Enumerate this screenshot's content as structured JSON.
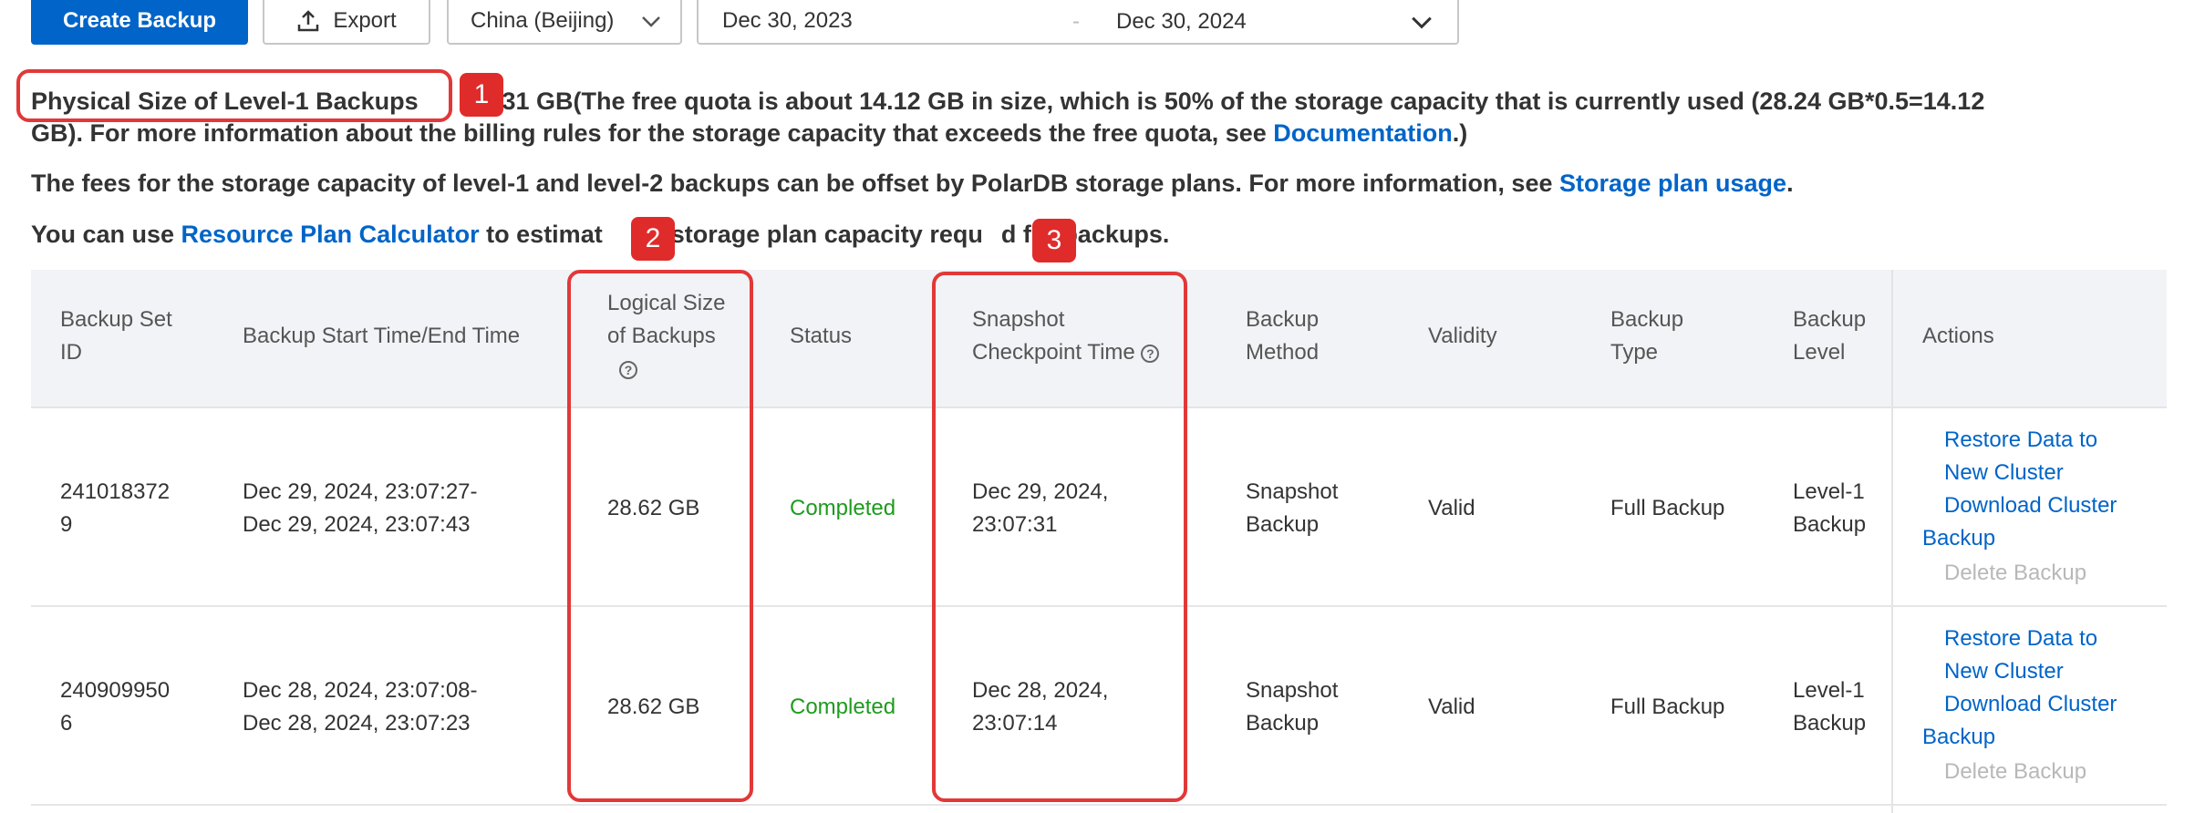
{
  "toolbar": {
    "create_label": "Create Backup",
    "export_label": "Export",
    "region": "China (Beijing)",
    "date_start": "Dec 30, 2023",
    "date_sep": "-",
    "date_end": "Dec 30, 2024"
  },
  "info": {
    "physical_label": "Physical Size of Level-1 Backups",
    "physical_rest": "2.31 GB(The free quota is about 14.12 GB in size, which is 50% of the storage capacity that is currently used (28.24 GB*0.5=14.12",
    "line1b_text": "GB). For more information about the billing rules for the storage capacity that exceeds the free quota, see ",
    "doc_link": "Documentation",
    "line1b_end": ".)",
    "line2_text": "The fees for the storage capacity of level-1 and level-2 backups can be offset by PolarDB storage plans. For more information, see ",
    "plan_link": "Storage plan usage",
    "line2_end": ".",
    "line3_a": "You can use ",
    "calc_link": "Resource Plan Calculator",
    "line3_b": " to estimat",
    "line3_c": "he storage plan capacity requ",
    "line3_d": "d for backups."
  },
  "table": {
    "headers": {
      "id_1": "Backup Set",
      "id_2": "ID",
      "time": "Backup Start Time/End Time",
      "logical_1": "Logical Size",
      "logical_2": "of Backups",
      "status": "Status",
      "snap_1": "Snapshot",
      "snap_2": "Checkpoint Time",
      "method_1": "Backup",
      "method_2": "Method",
      "validity": "Validity",
      "type_1": "Backup",
      "type_2": "Type",
      "level_1": "Backup",
      "level_2": "Level",
      "actions": "Actions"
    },
    "rows": [
      {
        "id_1": "241018372",
        "id_2": "9",
        "time_1": "Dec 29, 2024, 23:07:27-",
        "time_2": "Dec 29, 2024, 23:07:43",
        "logical": "28.62 GB",
        "status": "Completed",
        "snap_1": "Dec 29, 2024,",
        "snap_2": "23:07:31",
        "method_1": "Snapshot",
        "method_2": "Backup",
        "validity": "Valid",
        "type": "Full Backup",
        "level_1": "Level-1",
        "level_2": "Backup",
        "act_restore_1": "Restore Data to",
        "act_restore_2": "New Cluster",
        "act_download_1": "Download Cluster",
        "act_download_2": "Backup",
        "act_delete": "Delete Backup"
      },
      {
        "id_1": "240909950",
        "id_2": "6",
        "time_1": "Dec 28, 2024, 23:07:08-",
        "time_2": "Dec 28, 2024, 23:07:23",
        "logical": "28.62 GB",
        "status": "Completed",
        "snap_1": "Dec 28, 2024,",
        "snap_2": "23:07:14",
        "method_1": "Snapshot",
        "method_2": "Backup",
        "validity": "Valid",
        "type": "Full Backup",
        "level_1": "Level-1",
        "level_2": "Backup",
        "act_restore_1": "Restore Data to",
        "act_restore_2": "New Cluster",
        "act_download_1": "Download Cluster",
        "act_download_2": "Backup",
        "act_delete": "Delete Backup"
      }
    ]
  },
  "annotations": {
    "badge_1": "1",
    "badge_2": "2",
    "badge_3": "3"
  },
  "colors": {
    "primary": "#0064c8",
    "success": "#1e9b1e",
    "callout": "#e23838"
  }
}
